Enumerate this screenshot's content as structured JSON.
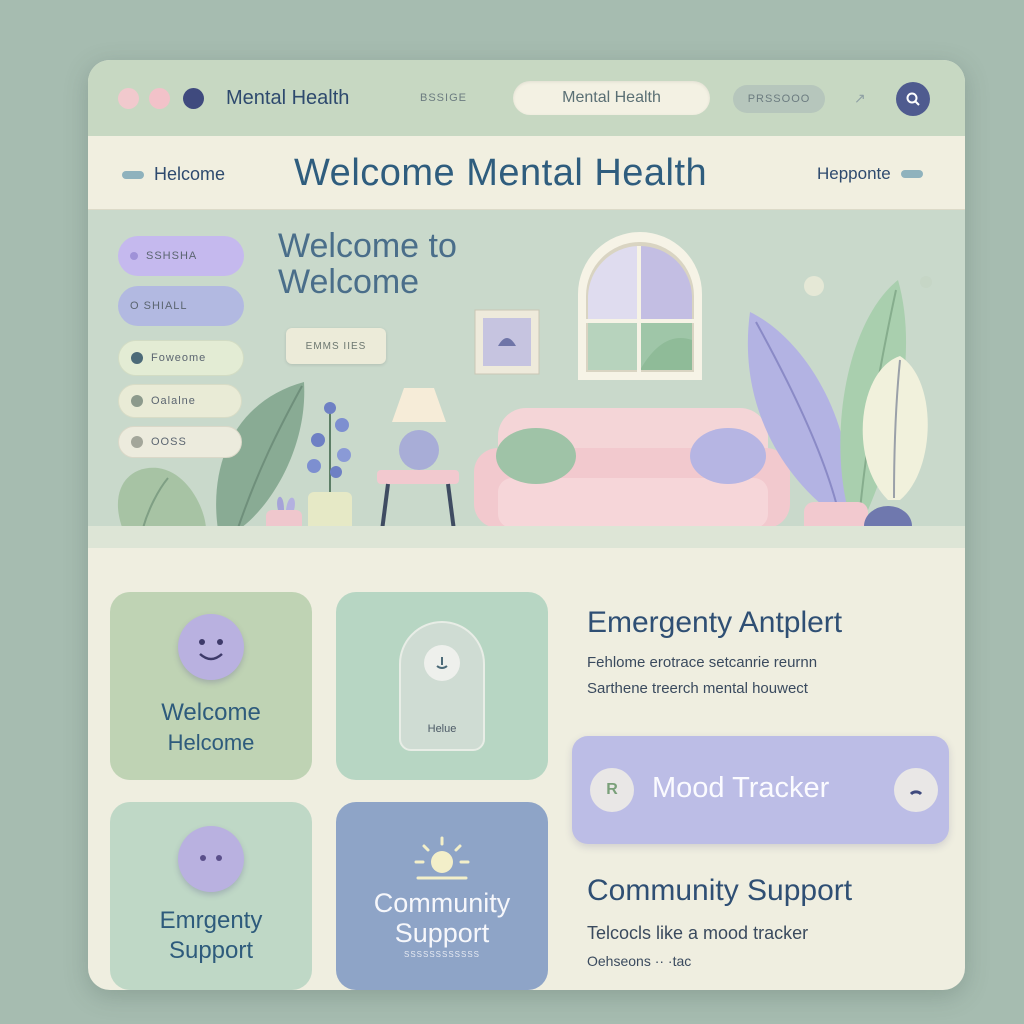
{
  "titlebar": {
    "app_title": "Mental Health",
    "label": "BSSIGE",
    "url_text": "Mental Health",
    "button_label": "PRSSOOO",
    "small_text": "↗",
    "window_dots": [
      "#f1c9cd",
      "#f2c2c9",
      "#3f4a7e"
    ]
  },
  "nav": {
    "left_link": "Helcome",
    "title": "Welcome Mental Health",
    "right_link": "Hepponte"
  },
  "hero": {
    "title_line1": "Welcome to",
    "title_line2": "Welcome",
    "tag": "EMMS IIES",
    "pills": [
      {
        "label": "SSHSHA",
        "color": "#c5b9ee"
      },
      {
        "label": "O SHIALL",
        "color": "#b2b9e1"
      },
      {
        "label": "Foweome",
        "color": "#e3ecd4"
      },
      {
        "label": "Oalalne",
        "color": "#e9ebd6"
      },
      {
        "label": "OOSS",
        "color": "#ecebdd"
      }
    ]
  },
  "cards": {
    "welcome": {
      "line1": "Welcome",
      "line2": "Helcome"
    },
    "hello": {
      "label": "Helue"
    },
    "emergency": {
      "line1": "Emrgenty",
      "line2": "Support"
    },
    "community": {
      "line1": "Community",
      "line2": "Support",
      "sub": "SSSSSSSSSSSS"
    }
  },
  "sections": {
    "emergency_title": "Emergenty Antplert",
    "emergency_line1": "Fehlome erotrace setcanrie reurnn",
    "emergency_line2": "Sarthene treerch mental houwect",
    "mood_label": "Mood Tracker",
    "mood_left_icon": "R",
    "community_title": "Community Support",
    "community_line1": "Telcocls like a mood tracker",
    "community_line2": "Oehseons ·· ·tac"
  },
  "icons": [
    "search-icon",
    "sun-icon",
    "smile-face-icon",
    "download-icon",
    "power-icon"
  ]
}
